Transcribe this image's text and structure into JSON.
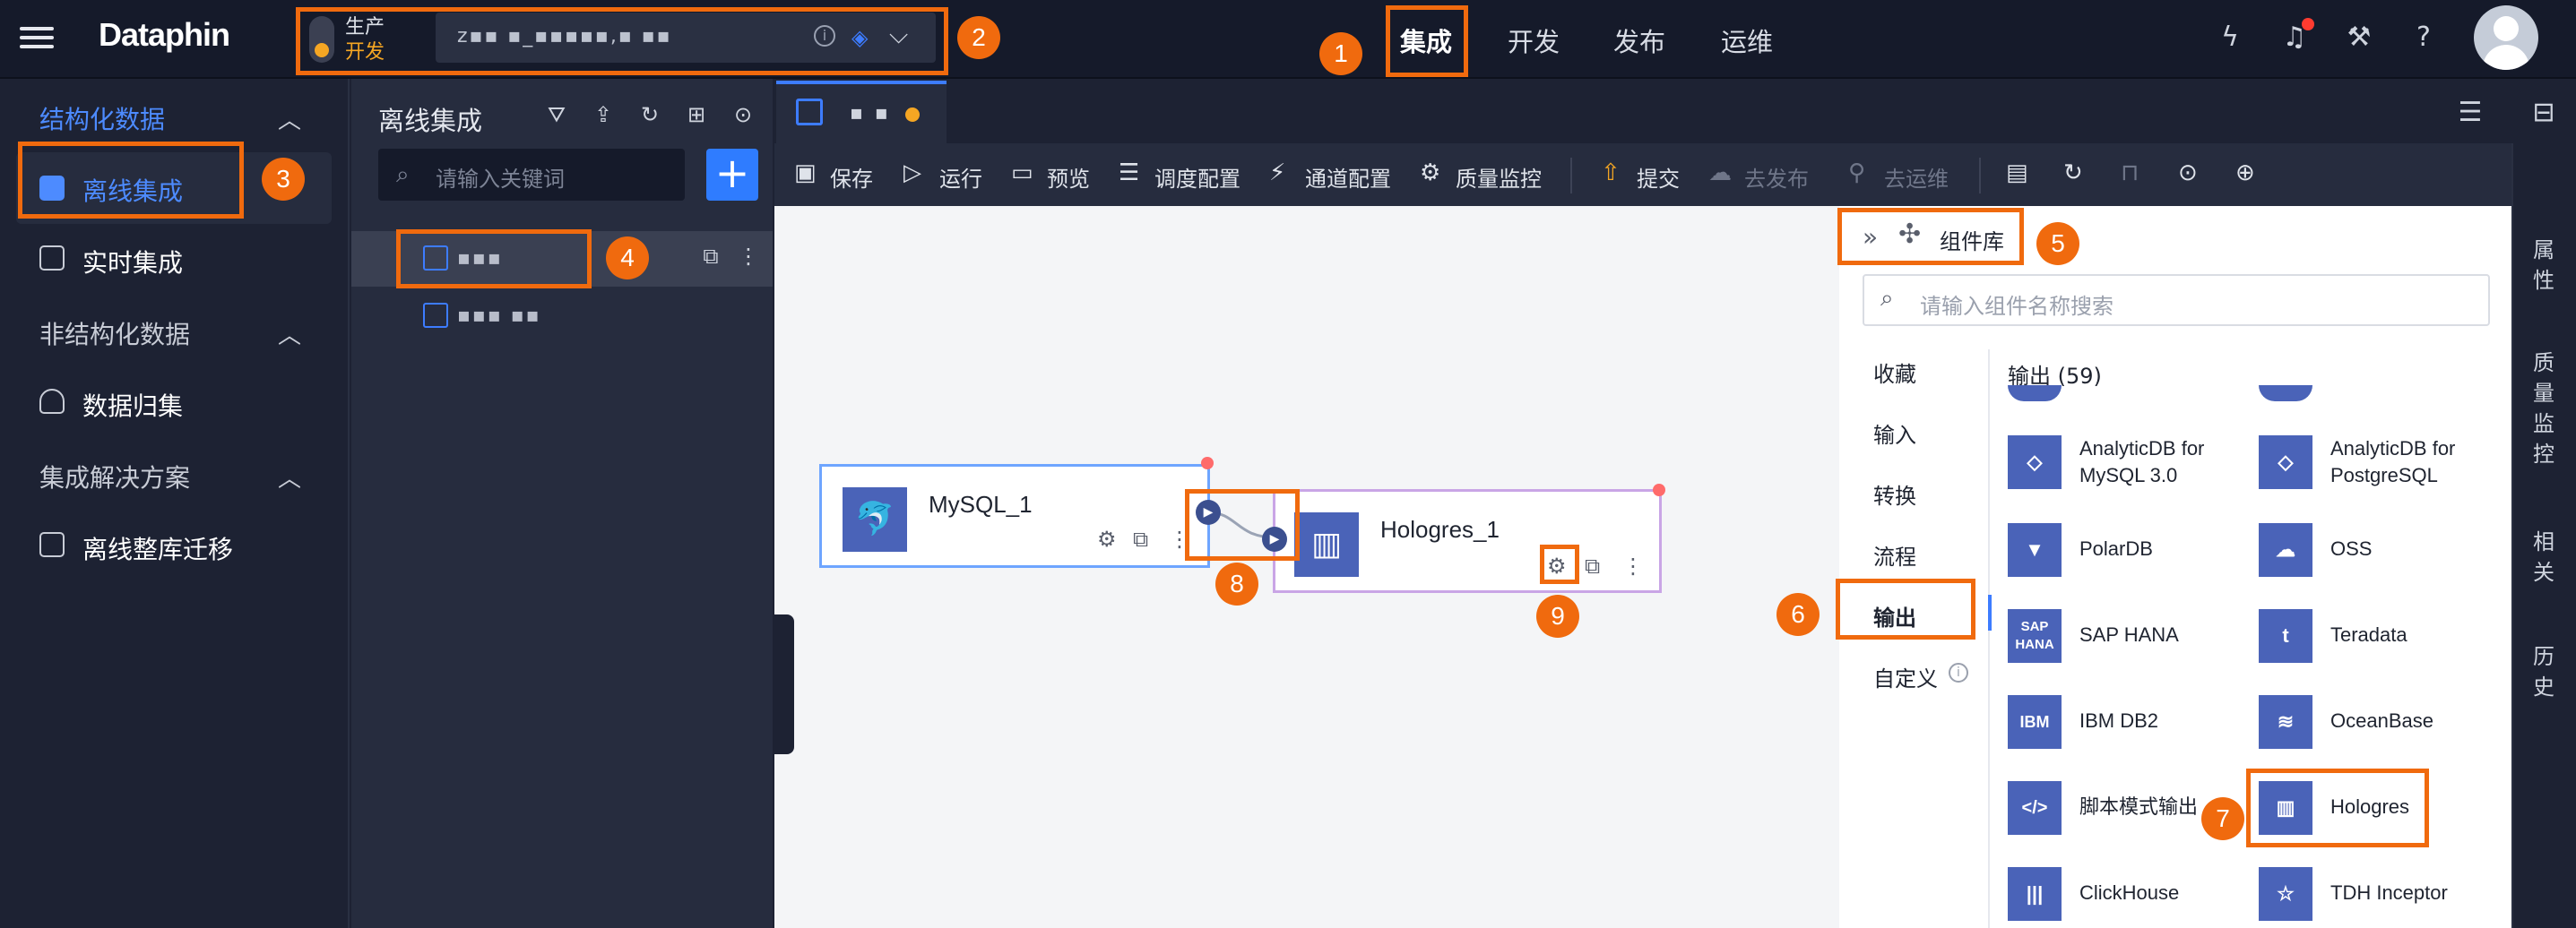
{
  "header": {
    "logo": "Dataphin",
    "env_top": "生产",
    "env_bottom": "开发",
    "project_name": "z▪▪ ▪_▪▪▪▪▪,▪ ▪▪",
    "nav": [
      "集成",
      "开发",
      "发布",
      "运维"
    ]
  },
  "sidebar": {
    "structured": "结构化数据",
    "offline": "离线集成",
    "realtime": "实时集成",
    "unstructured": "非结构化数据",
    "archive": "数据归集",
    "solutions": "集成解决方案",
    "migration": "离线整库迁移"
  },
  "tree": {
    "title": "离线集成",
    "search_placeholder": "请输入关键词",
    "items": [
      "▪▪▪",
      "▪▪▪ ▪▪"
    ]
  },
  "tab": {
    "name": "▪ ▪"
  },
  "toolbar": {
    "save": "保存",
    "run": "运行",
    "preview": "预览",
    "schedule": "调度配置",
    "channel": "通道配置",
    "quality": "质量监控",
    "submit": "提交",
    "publish": "去发布",
    "ops": "去运维"
  },
  "canvas": {
    "source_node": "MySQL_1",
    "target_node": "Hologres_1"
  },
  "library": {
    "title": "组件库",
    "search_placeholder": "请输入组件名称搜索",
    "categories": [
      "收藏",
      "输入",
      "转换",
      "流程",
      "输出",
      "自定义"
    ],
    "section": "输出 (59)",
    "components": [
      {
        "name": "AnalyticDB for MySQL 3.0",
        "l1": "AnalyticDB for",
        "l2": "MySQL 3.0"
      },
      {
        "name": "AnalyticDB for PostgreSQL",
        "l1": "AnalyticDB for",
        "l2": "PostgreSQL"
      },
      {
        "name": "PolarDB"
      },
      {
        "name": "OSS"
      },
      {
        "name": "SAP HANA"
      },
      {
        "name": "Teradata"
      },
      {
        "name": "IBM DB2"
      },
      {
        "name": "OceanBase"
      },
      {
        "name": "脚本模式输出"
      },
      {
        "name": "Hologres"
      },
      {
        "name": "ClickHouse"
      },
      {
        "name": "TDH Inceptor"
      }
    ]
  },
  "rail": [
    "属性",
    "质量监控",
    "相关",
    "历史"
  ],
  "markers": [
    "1",
    "2",
    "3",
    "4",
    "5",
    "6",
    "7",
    "8",
    "9"
  ],
  "colors": {
    "accent": "#3d7cff",
    "highlight": "#f06a0e",
    "env_dev": "#f5a623"
  }
}
